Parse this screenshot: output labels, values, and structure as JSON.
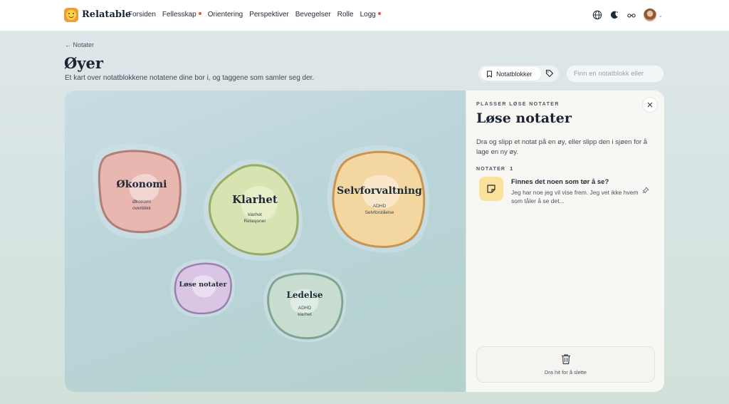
{
  "app": {
    "brand": "Relatable"
  },
  "nav": {
    "items": [
      {
        "label": "Forsiden",
        "dot": false
      },
      {
        "label": "Fellesskap",
        "dot": true
      },
      {
        "label": "Orientering",
        "dot": false
      },
      {
        "label": "Perspektiver",
        "dot": false
      },
      {
        "label": "Bevegelser",
        "dot": false
      },
      {
        "label": "Rolle",
        "dot": false
      },
      {
        "label": "Logg",
        "dot": true
      }
    ],
    "icons": [
      "globe-icon",
      "moon-icon",
      "glasses-icon",
      "avatar"
    ]
  },
  "header": {
    "back_label": "← Notater",
    "title": "Øyer",
    "subtitle": "Et kart over notatblokkene notatene dine bor i, og taggene som samler seg der.",
    "toggle_notebooks": "Notatblokker",
    "search_placeholder": "Finn en notatblokk eller"
  },
  "map": {
    "islands": [
      {
        "id": "okonomi",
        "name": "Økonomi",
        "tags": [
          "Økonomi",
          "overblikk"
        ],
        "color": "#e8b7b0"
      },
      {
        "id": "klarhet",
        "name": "Klarhet",
        "tags": [
          "klarhet",
          "Relasjoner"
        ],
        "color": "#d7e3b0"
      },
      {
        "id": "selvforvaltning",
        "name": "Selvforvaltning",
        "tags": [
          "ADHD",
          "Selvforståelse"
        ],
        "color": "#f4d7a0"
      },
      {
        "id": "lose-notater",
        "name": "Løse notater",
        "tags": [],
        "color": "#d9c6e4"
      },
      {
        "id": "ledelse",
        "name": "Ledelse",
        "tags": [
          "ADHD",
          "klarhet"
        ],
        "color": "#c8ddd0"
      }
    ]
  },
  "panel": {
    "kicker": "PLASSER LØSE NOTATER",
    "title": "Løse notater",
    "description": "Dra og slipp et notat på en øy, eller slipp den i sjøen for å lage en ny øy.",
    "notes_label": "NOTATER",
    "notes_count": "1",
    "notes": [
      {
        "title": "Finnes det noen som tør å se?",
        "body": "Jeg har noe jeg vil vise frem. Jeg vet ikke hvem som tåler å se det..."
      }
    ],
    "trash_label": "Dra hit for å slette"
  }
}
